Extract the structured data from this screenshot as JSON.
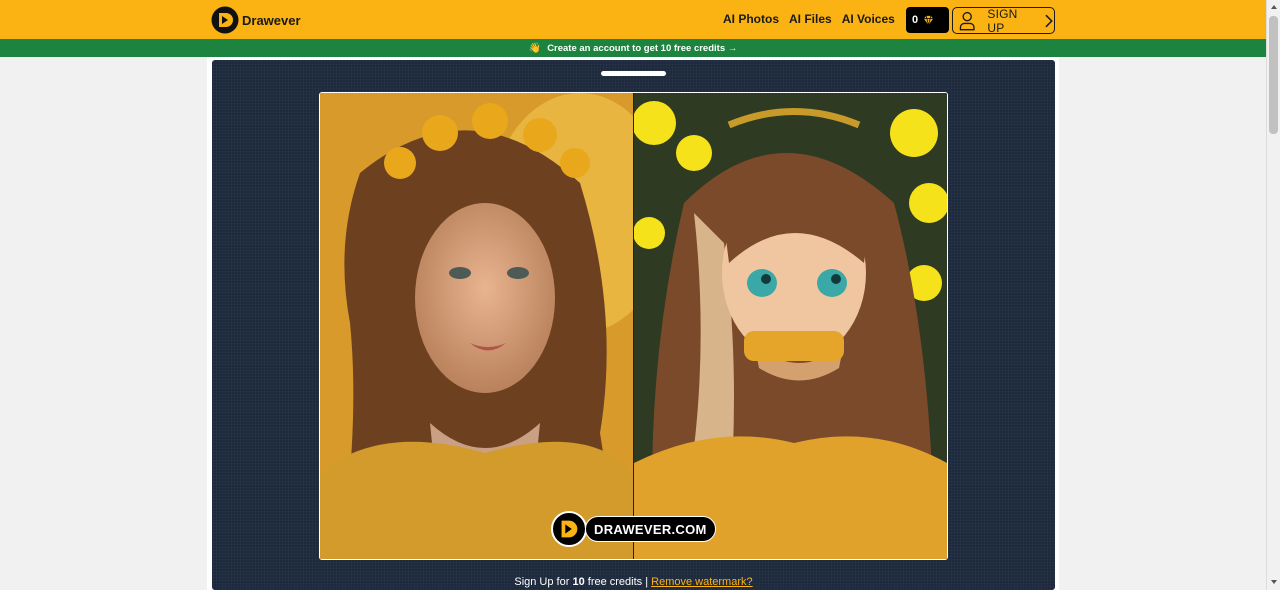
{
  "header": {
    "brand": "Drawever",
    "nav": [
      {
        "label": "AI Photos"
      },
      {
        "label": "AI Files"
      },
      {
        "label": "AI Voices"
      }
    ],
    "credits": "0",
    "signup_label": "SIGN UP"
  },
  "banner": {
    "emoji": "👋",
    "text": "Create an account to get 10 free credits →"
  },
  "viewer": {
    "watermark": "DRAWEVER.COM",
    "footer_prefix": "Sign Up for ",
    "footer_count": "10",
    "footer_suffix": " free credits | ",
    "footer_link": "Remove watermark?"
  },
  "colors": {
    "brand_yellow": "#fbb313",
    "banner_green": "#1c843e",
    "panel_navy": "#1e2a3b"
  },
  "icons": [
    "drawever-logo-icon",
    "gem-icon",
    "user-icon",
    "chevron-right-icon"
  ]
}
